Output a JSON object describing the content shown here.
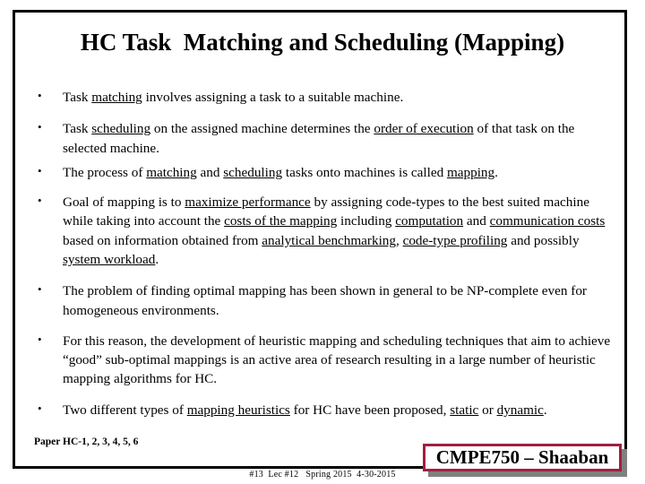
{
  "slide": {
    "title": "HC Task  Matching and Scheduling (Mapping)",
    "bullet_mark": "•",
    "bullets": [
      {
        "id": "bullet-task-matching",
        "html": "Task <u>matching</u> involves assigning a task to a suitable machine.",
        "plain": "Task matching involves assigning a task to a suitable machine."
      },
      {
        "id": "bullet-task-scheduling",
        "html": "Task <u>scheduling</u> on the assigned machine determines the <u>order of execution</u> of that task on the selected machine.",
        "plain": "Task scheduling on the assigned machine determines the order of execution of that task on the selected machine."
      },
      {
        "id": "bullet-mapping-definition",
        "html": "The process of <u>matching</u> and <u>scheduling</u> tasks onto machines is called <u>mapping</u>.",
        "plain": "The process of matching and scheduling tasks onto machines is called mapping."
      },
      {
        "id": "bullet-goal-of-mapping",
        "html": "Goal of mapping is to <u>maximize performance</u> by assigning code-types to the best suited machine while taking into account the <u>costs of the mapping</u> including <u>computation</u> and <u>communication costs</u> based on information obtained from <u>analytical benchmarking</u>, <u>code-type profiling</u> and possibly <u>system workload</u>.",
        "plain": "Goal of mapping is to maximize performance by assigning code-types to the best suited machine while taking into account the costs of the mapping including computation and communication costs based on information obtained from analytical benchmarking, code-type profiling and possibly system workload."
      },
      {
        "id": "bullet-np-complete",
        "html": "The problem of finding optimal mapping has been shown in general to be NP-complete even for homogeneous environments.",
        "plain": "The problem of finding optimal mapping has been shown in general to be NP-complete even for homogeneous environments."
      },
      {
        "id": "bullet-heuristic-research",
        "html": "For this reason, the development of heuristic mapping and scheduling techniques that aim to achieve &ldquo;good&rdquo; sub-optimal mappings is an active area of research resulting in a large number of heuristic mapping algorithms for HC.",
        "plain": "For this reason, the development of heuristic mapping and scheduling techniques that aim to achieve “good” sub-optimal mappings is an active area of research resulting in a large number of heuristic mapping algorithms for HC."
      },
      {
        "id": "bullet-static-dynamic",
        "html": "Two different types of <u>mapping heuristics</u> for HC have been proposed, <u>static</u> or <u>dynamic</u>.",
        "plain": "Two different types of mapping heuristics for HC have been proposed, static or dynamic."
      }
    ]
  },
  "footer": {
    "paper_reference": "Paper HC-1, 2, 3, 4, 5, 6",
    "slide_info": "#13  Lec #12   Spring 2015  4-30-2015",
    "badge_label": "CMPE750 – Shaaban"
  },
  "colors": {
    "frame_border": "#000000",
    "badge_border": "#A02040",
    "badge_background": "#FFFFFF",
    "badge_shadow": "#808080",
    "text": "#000000",
    "background": "#FFFFFF"
  }
}
